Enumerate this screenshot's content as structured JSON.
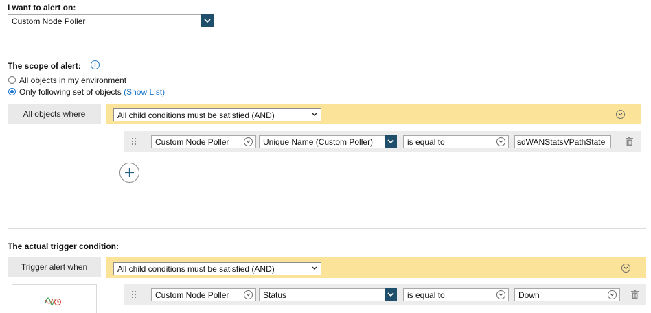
{
  "alert_on": {
    "label": "I want to alert on:",
    "value": "Custom Node Poller"
  },
  "scope": {
    "title": "The scope of alert:",
    "info_icon": "info-icon",
    "options": [
      {
        "label": "All objects in my environment",
        "selected": false
      },
      {
        "label": "Only following set of objects",
        "selected": true,
        "link": "(Show List)"
      }
    ],
    "where_label": "All objects where",
    "logic": "All child conditions must be satisfied (AND)",
    "condition": {
      "object": "Custom Node Poller",
      "field": "Unique Name (Custom Poller)",
      "operator": "is equal to",
      "value": "sdWANStatsVPathState"
    }
  },
  "trigger": {
    "title": "The actual trigger condition:",
    "when_label": "Trigger alert when",
    "logic": "All child conditions must be satisfied (AND)",
    "condition": {
      "object": "Custom Node Poller",
      "field": "Status",
      "operator": "is equal to",
      "value": "Down"
    }
  },
  "colors": {
    "accent": "#204f6b",
    "link": "#1f77c6",
    "yellow": "#fbe39a",
    "radio": "#1a73c8"
  }
}
